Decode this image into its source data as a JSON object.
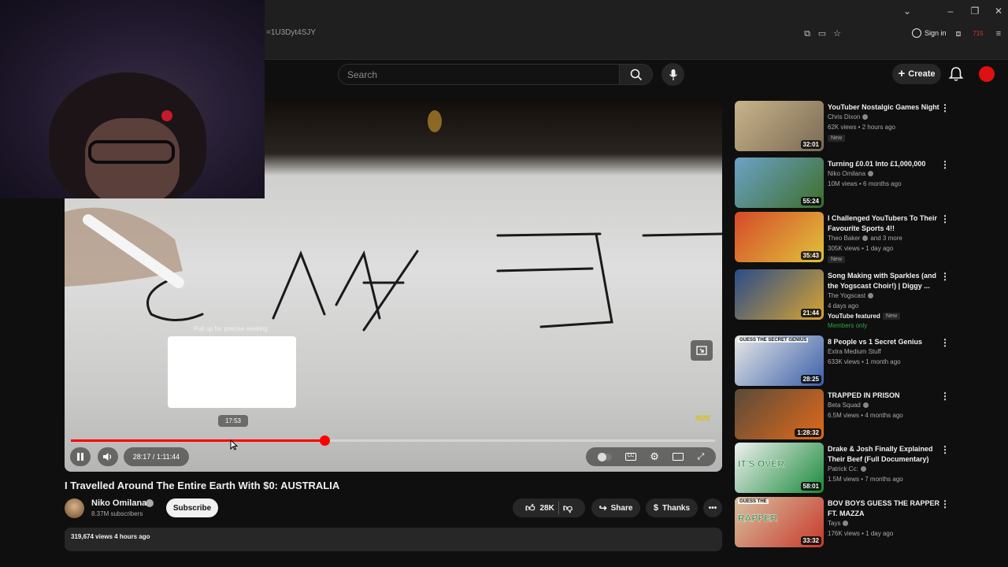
{
  "browser": {
    "url": "=1U3Dyt4SJY",
    "sign_in": "Sign in",
    "ext_badge": "715"
  },
  "header": {
    "search_placeholder": "Search",
    "create_label": "Create"
  },
  "player": {
    "seek_hint": "Pull up for precise seeking",
    "seek_preview_time": "17:53",
    "time_display": "28:17 / 1:11:44",
    "progress_fraction": 0.394,
    "hover_fraction": 0.25,
    "watermark": "NØ$",
    "accent": "#ff0000"
  },
  "video": {
    "title": "I Travelled Around The Entire Earth With $0: AUSTRALIA",
    "channel": "Niko Omilana",
    "subscribers": "8.37M subscribers",
    "subscribe_label": "Subscribe",
    "likes": "28K",
    "share_label": "Share",
    "thanks_label": "Thanks",
    "views_age": "319,674 views  4 hours ago"
  },
  "sidebar": {
    "items": [
      {
        "title": "YouTuber Nostalgic Games Night",
        "channel": "Chris Dixon",
        "verified": true,
        "meta": "62K views • 2 hours ago",
        "duration": "32:01",
        "badge": "New",
        "thumb_colors": [
          "#c9b48a",
          "#7a6a54"
        ]
      },
      {
        "title": "Turning £0.01 Into £1,000,000",
        "channel": "Niko Omilana",
        "verified": true,
        "meta": "10M views • 6 months ago",
        "duration": "55:24",
        "badge": "",
        "thumb_colors": [
          "#6ba3c8",
          "#3e6e2a"
        ]
      },
      {
        "title": "I Challenged YouTubers To Their Favourite Sports 4!!",
        "channel": "Theo Baker",
        "verified": true,
        "channel_extra": "and 3 more",
        "meta": "305K views • 1 day ago",
        "duration": "35:43",
        "badge": "New",
        "thumb_colors": [
          "#d64a2a",
          "#e0c23a"
        ]
      },
      {
        "title": "Song Making with Sparkles (and the Yogscast Choir!) | Diggy ...",
        "channel": "The Yogscast",
        "verified": true,
        "meta": "4 days ago",
        "duration": "21:44",
        "featured": "YouTube featured",
        "badge": "New",
        "members": "Members only",
        "thumb_colors": [
          "#2a4c8a",
          "#d8a430"
        ]
      },
      {
        "title": "8 People vs 1 Secret Genius",
        "channel": "Extra Medium Stuff",
        "verified": false,
        "meta": "633K views • 1 month ago",
        "duration": "28:25",
        "badge": "",
        "thumb_top": "GUESS THE SECRET GENIUS",
        "thumb_colors": [
          "#e8e8e8",
          "#3a5fa8"
        ]
      },
      {
        "title": "TRAPPED IN PRISON",
        "channel": "Beta Squad",
        "verified": true,
        "meta": "6.5M views • 4 months ago",
        "duration": "1:28:32",
        "badge": "",
        "thumb_colors": [
          "#5a4a3a",
          "#e06a1a"
        ]
      },
      {
        "title": "Drake & Josh Finally Explained Their Beef (Full Documentary)",
        "channel": "Patrick Cc:",
        "verified": true,
        "meta": "1.5M views • 7 months ago",
        "duration": "58:01",
        "badge": "",
        "thumb_big": "IT'S OVER",
        "thumb_colors": [
          "#f0f0f0",
          "#1a8a3a"
        ]
      },
      {
        "title": "BOV BOYS GUESS THE RAPPER FT. MAZZA",
        "channel": "Tays",
        "verified": true,
        "meta": "176K views • 1 day ago",
        "duration": "33:32",
        "badge": "",
        "thumb_big": "RAPPER",
        "thumb_top": "GUESS THE",
        "thumb_colors": [
          "#d8c2a2",
          "#c8382a"
        ]
      }
    ]
  }
}
